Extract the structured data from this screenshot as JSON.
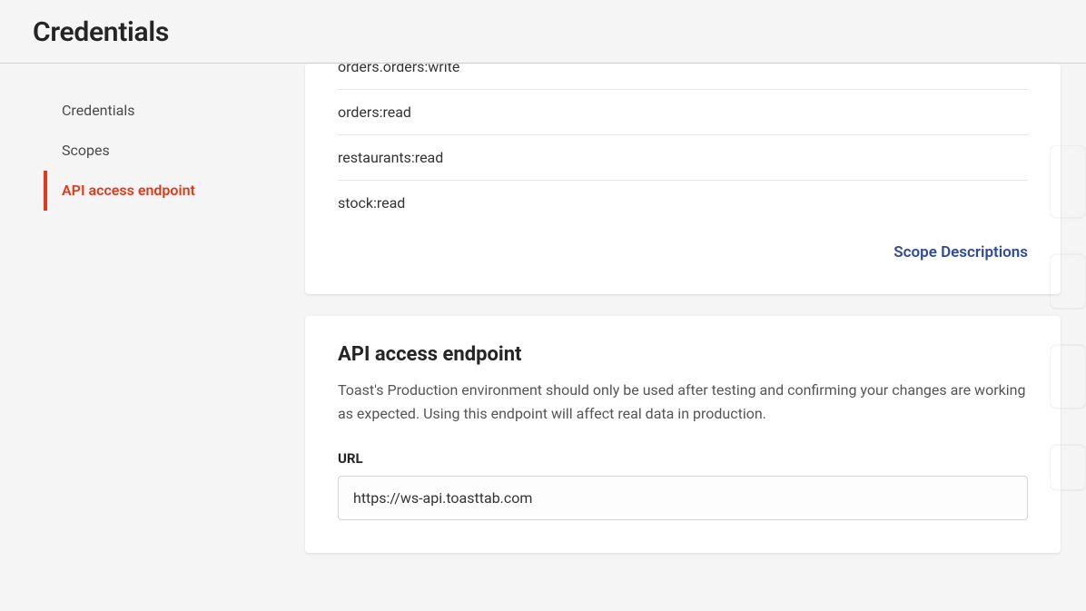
{
  "header": {
    "title": "Credentials"
  },
  "sidebar": {
    "items": [
      {
        "label": "Credentials",
        "active": false
      },
      {
        "label": "Scopes",
        "active": false
      },
      {
        "label": "API access endpoint",
        "active": true
      }
    ]
  },
  "scopes": {
    "rows": [
      "orders.orders:write",
      "orders:read",
      "restaurants:read",
      "stock:read"
    ],
    "link_label": "Scope Descriptions"
  },
  "endpoint": {
    "heading": "API access endpoint",
    "description": "Toast's Production environment should only be used after testing and confirming your changes are working as expected. Using this endpoint will affect real data in production.",
    "url_label": "URL",
    "url_value": "https://ws-api.toasttab.com"
  }
}
